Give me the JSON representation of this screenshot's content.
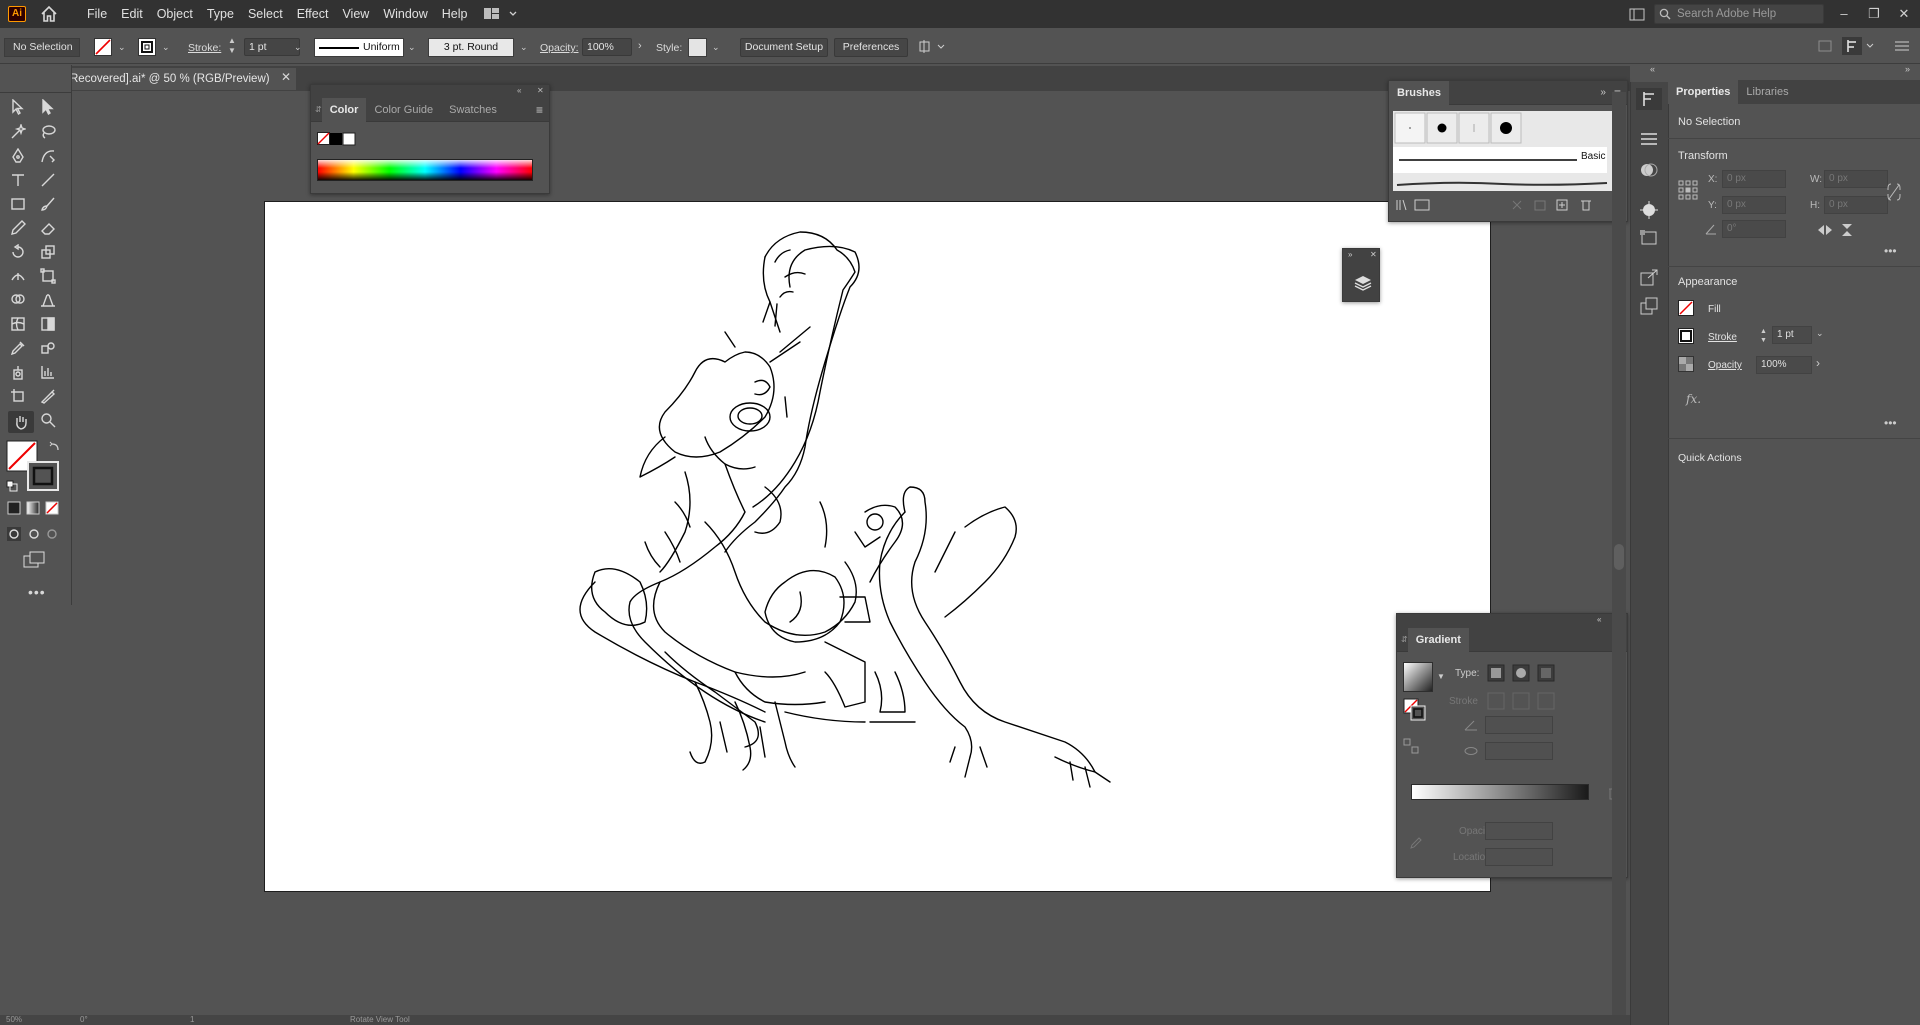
{
  "app": {
    "logo_text": "Ai",
    "menu": [
      "File",
      "Edit",
      "Object",
      "Type",
      "Select",
      "Effect",
      "View",
      "Window",
      "Help"
    ],
    "search_placeholder": "Search Adobe Help"
  },
  "control_bar": {
    "selection": "No Selection",
    "stroke_label": "Stroke:",
    "stroke_weight": "1 pt",
    "profile": "Uniform",
    "brush": "3 pt. Round",
    "opacity_label": "Opacity:",
    "opacity": "100%",
    "style_label": "Style:",
    "document_setup": "Document Setup",
    "preferences": "Preferences"
  },
  "document": {
    "tab_title": "Recovered].ai* @ 50 % (RGB/Preview)"
  },
  "color_panel": {
    "tabs": [
      "Color",
      "Color Guide",
      "Swatches"
    ]
  },
  "brushes_panel": {
    "title": "Brushes",
    "basic_label": "Basic"
  },
  "gradient_panel": {
    "title": "Gradient",
    "type_label": "Type:",
    "stroke_label": "Stroke",
    "opacity_label": "Opacity:",
    "location_label": "Location:"
  },
  "properties": {
    "tabs": [
      "Properties",
      "Libraries"
    ],
    "selection": "No Selection",
    "transform_title": "Transform",
    "x_label": "X:",
    "y_label": "Y:",
    "w_label": "W:",
    "h_label": "H:",
    "x_value": "0 px",
    "y_value": "0 px",
    "w_value": "0 px",
    "h_value": "0 px",
    "angle_value": "0°",
    "appearance_title": "Appearance",
    "fill_label": "Fill",
    "stroke_label": "Stroke",
    "stroke_value": "1 pt",
    "opacity_label": "Opacity",
    "opacity_value": "100%",
    "fx_label": "fx.",
    "quick_actions_title": "Quick Actions"
  },
  "status_bar": {
    "zoom": "50%",
    "rotation": "0°",
    "artboard": "1",
    "tool": "Rotate View Tool"
  },
  "colors": {
    "chrome_dark": "#323232",
    "panel": "#535353",
    "artboard": "#ffffff",
    "app_orange": "#ff9a00"
  }
}
